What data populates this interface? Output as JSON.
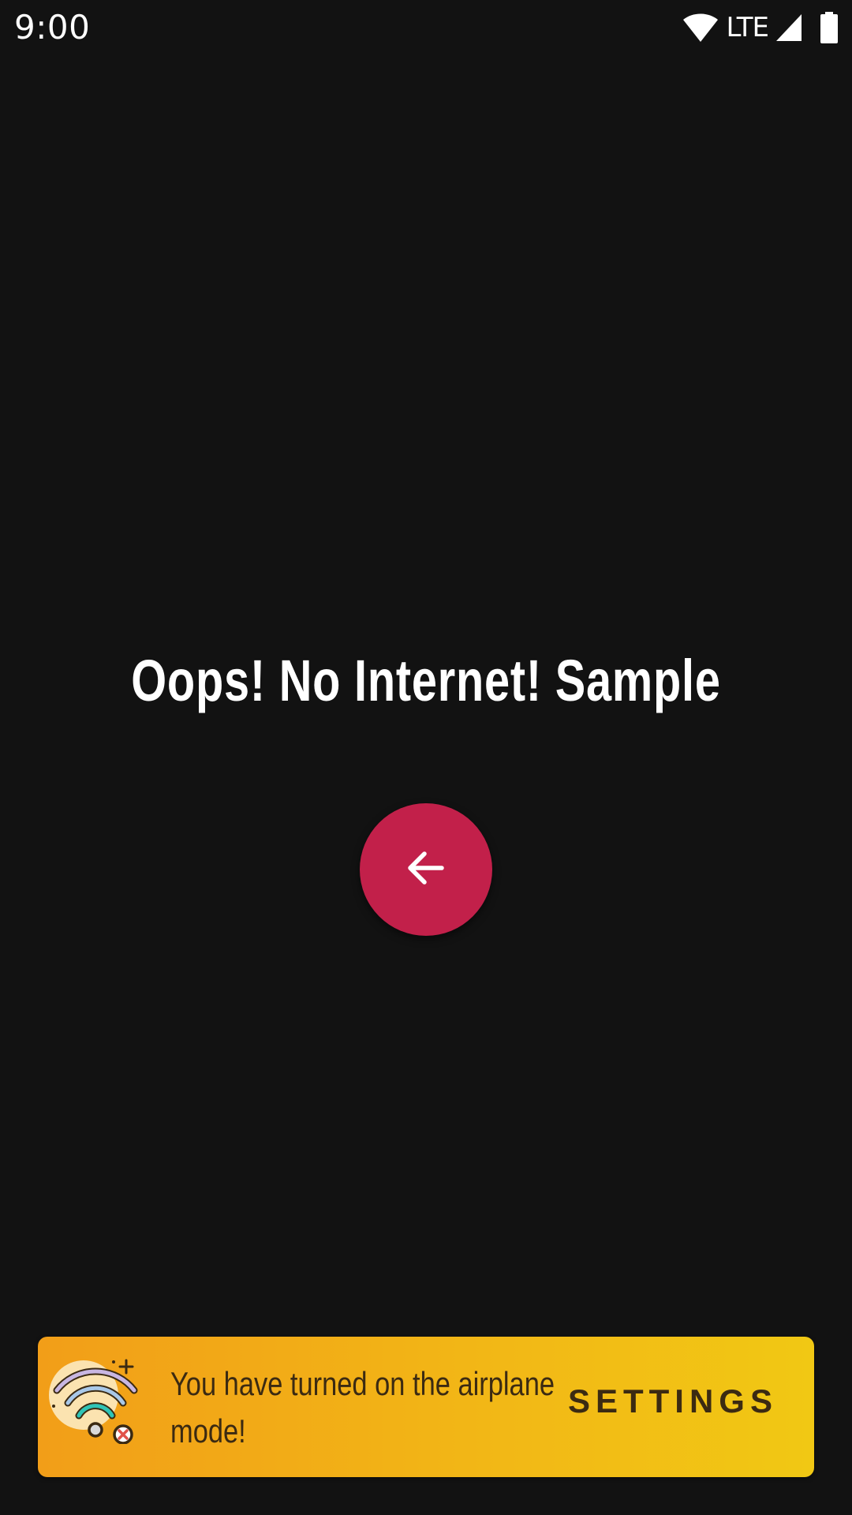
{
  "status_bar": {
    "time": "9:00",
    "network_label": "LTE",
    "icons": [
      "wifi-icon",
      "cellular-signal-icon",
      "battery-icon"
    ]
  },
  "main": {
    "headline": "Oops! No Internet! Sample",
    "back_button_icon": "arrow-left-icon",
    "back_button_color": "#c2204a"
  },
  "snackbar": {
    "icon": "wifi-off-icon",
    "message": "You have turned on the airplane mode!",
    "action_label": "SETTINGS",
    "gradient": [
      "#f29e18",
      "#f1c814"
    ]
  }
}
